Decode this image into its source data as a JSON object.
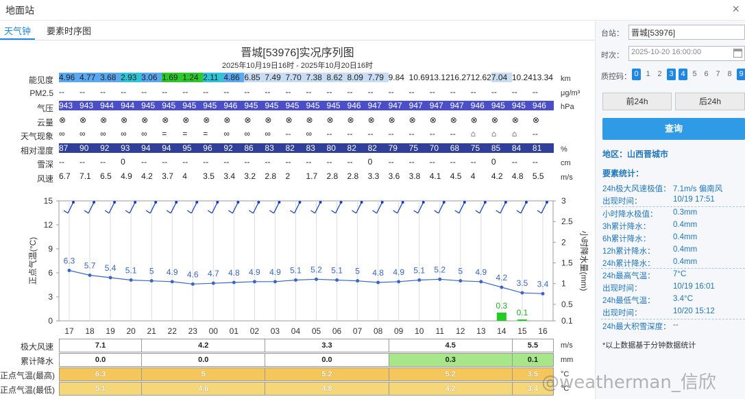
{
  "window": {
    "title": "地面站",
    "close": "×"
  },
  "tabs": [
    {
      "label": "天气钟"
    },
    {
      "label": "要素时序图"
    }
  ],
  "chart_header": {
    "title": "晋城[53976]实况序列图",
    "subtitle": "2025年10月19日16时 - 2025年10月20日16时"
  },
  "table": {
    "hours": [
      "17",
      "18",
      "19",
      "20",
      "21",
      "22",
      "23",
      "00",
      "01",
      "02",
      "03",
      "04",
      "05",
      "06",
      "07",
      "08",
      "09",
      "10",
      "11",
      "12",
      "13",
      "14",
      "15",
      "16"
    ],
    "rows": [
      {
        "label": "能见度",
        "unit": "km",
        "values": [
          "4.96",
          "4.77",
          "3.68",
          "2.93",
          "3.06",
          "1.69",
          "1.24",
          "2.11",
          "4.86",
          "6.85",
          "7.49",
          "7.70",
          "7.38",
          "8.62",
          "8.09",
          "7.79",
          "9.84",
          "10.69",
          "13.12",
          "16.27",
          "12.62",
          "7.04",
          "10.24",
          "13.34"
        ],
        "colors": [
          "#5aa8f0",
          "#5aa8f0",
          "#5aa8f0",
          "#2ec4d4",
          "#5aa8f0",
          "#2cc82c",
          "#2cc82c",
          "#2ec4d4",
          "#5aa8f0",
          "#c8dcf2",
          "#c8dcf2",
          "#c8dcf2",
          "#c8dcf2",
          "#c8dcf2",
          "#c8dcf2",
          "#c8dcf2",
          "#ffffff",
          "#ffffff",
          "#ffffff",
          "#ffffff",
          "#ffffff",
          "#c8dcf2",
          "#ffffff",
          "#ffffff"
        ]
      },
      {
        "label": "PM2.5",
        "unit": "μg/m³",
        "values": [
          "--",
          "--",
          "--",
          "--",
          "--",
          "--",
          "--",
          "--",
          "--",
          "--",
          "--",
          "--",
          "--",
          "--",
          "--",
          "--",
          "--",
          "--",
          "--",
          "--",
          "--",
          "--",
          "--",
          "--"
        ]
      },
      {
        "label": "气压",
        "unit": "hPa",
        "values": [
          "943",
          "943",
          "944",
          "944",
          "945",
          "945",
          "945",
          "945",
          "946",
          "945",
          "945",
          "945",
          "945",
          "945",
          "946",
          "947",
          "947",
          "947",
          "947",
          "947",
          "946",
          "945",
          "945",
          "946"
        ],
        "fill": "#4a4fc8",
        "text_color": "#ffffff"
      },
      {
        "label": "云量",
        "unit": "",
        "values": [
          "⊗",
          "⊗",
          "⊗",
          "⊗",
          "⊗",
          "⊗",
          "⊗",
          "⊗",
          "⊗",
          "⊗",
          "⊗",
          "⊗",
          "⊗",
          "⊗",
          "⊗",
          "⊗",
          "⊗",
          "⊗",
          "⊗",
          "⊗",
          "⊗",
          "⊗",
          "⊗",
          "⊗"
        ]
      },
      {
        "label": "天气现象",
        "unit": "",
        "values": [
          "∞",
          "∞",
          "∞",
          "∞",
          "∞",
          "=",
          "=",
          "=",
          "∞",
          "∞",
          "∞",
          "--",
          "∞",
          "--",
          "--",
          "--",
          "--",
          "--",
          "--",
          "--",
          "⌂",
          "⌂",
          "⌂",
          "--"
        ]
      },
      {
        "label": "相对湿度",
        "unit": "%",
        "values": [
          "87",
          "90",
          "92",
          "93",
          "94",
          "94",
          "95",
          "96",
          "92",
          "86",
          "83",
          "82",
          "83",
          "80",
          "82",
          "82",
          "79",
          "75",
          "70",
          "68",
          "75",
          "85",
          "84",
          "81"
        ],
        "fill": "#2f3f9a",
        "text_color": "#ffffff"
      },
      {
        "label": "雪深",
        "unit": "cm",
        "values": [
          "--",
          "--",
          "--",
          "0",
          "--",
          "--",
          "--",
          "--",
          "--",
          "--",
          "--",
          "--",
          "--",
          "--",
          "--",
          "0",
          "--",
          "--",
          "--",
          "--",
          "--",
          "0",
          "--",
          "--"
        ]
      },
      {
        "label": "风速",
        "unit": "m/s",
        "values": [
          "6.7",
          "7.1",
          "6.5",
          "4.9",
          "4.2",
          "3.7",
          "4",
          "3.5",
          "3.4",
          "3.2",
          "2.8",
          "2",
          "1.7",
          "2.8",
          "2.8",
          "3.3",
          "3.6",
          "3.8",
          "4.1",
          "4.5",
          "4",
          "4.2",
          "4.8",
          "5.5"
        ]
      }
    ]
  },
  "chart_data": {
    "type": "line",
    "x": [
      "17",
      "18",
      "19",
      "20",
      "21",
      "22",
      "23",
      "00",
      "01",
      "02",
      "03",
      "04",
      "05",
      "06",
      "07",
      "08",
      "09",
      "10",
      "11",
      "12",
      "13",
      "14",
      "15",
      "16"
    ],
    "series": [
      {
        "values": [
          6.3,
          5.7,
          5.4,
          5.1,
          5,
          4.9,
          4.6,
          4.7,
          4.8,
          4.9,
          4.9,
          5.1,
          5.2,
          5.1,
          5,
          4.8,
          4.9,
          5.1,
          5.2,
          5,
          4.9,
          4.2,
          3.5,
          3.4
        ]
      }
    ],
    "precip": {
      "values": [
        null,
        null,
        null,
        null,
        null,
        null,
        null,
        null,
        null,
        null,
        null,
        null,
        null,
        null,
        null,
        null,
        null,
        null,
        null,
        null,
        null,
        0.3,
        0.1,
        null
      ]
    },
    "ylabel": "正点气温(°C)",
    "y2label": "小时降水量(mm)",
    "ylim": [
      0,
      15
    ],
    "y2lim": [
      0.1,
      3
    ],
    "yticks": [
      "0",
      "3",
      "6",
      "9",
      "12",
      "15"
    ],
    "y2ticks": [
      "0.1",
      "0.5",
      "1",
      "1.5",
      "2",
      "2.5",
      "3"
    ],
    "line_color": "#3a66c4",
    "bar_color": "#22cc22",
    "grid": true
  },
  "summary_table": {
    "rows": [
      {
        "label": "极大风速",
        "unit": "m/s",
        "values": [
          "7.1",
          "4.2",
          "3.3",
          "4.5",
          "5.5"
        ]
      },
      {
        "label": "累计降水",
        "unit": "mm",
        "values": [
          "0.0",
          "0.0",
          "0.0",
          "0.3",
          "0.1"
        ]
      },
      {
        "label": "正点气温(最高)",
        "unit": "°C",
        "values": [
          "6.3",
          "5",
          "5.2",
          "5.2",
          "3.5"
        ]
      },
      {
        "label": "正点气温(最低)",
        "unit": "°C",
        "values": [
          "5.1",
          "4.6",
          "4.8",
          "4.2",
          "3.4"
        ]
      }
    ]
  },
  "sidebar": {
    "station_label": "台站：",
    "station_value": "晋城[53976]",
    "time_label": "时次：",
    "time_value": "2025-10-20 16:00:00",
    "qc_label": "质控码：",
    "qc_codes": [
      {
        "code": "0",
        "on": true
      },
      {
        "code": "1",
        "on": false
      },
      {
        "code": "2",
        "on": false
      },
      {
        "code": "3",
        "on": true
      },
      {
        "code": "4",
        "on": true
      },
      {
        "code": "5",
        "on": false
      },
      {
        "code": "6",
        "on": false
      },
      {
        "code": "7",
        "on": false
      },
      {
        "code": "8",
        "on": false
      },
      {
        "code": "9",
        "on": true
      }
    ],
    "prev_button": "前24h",
    "next_button": "后24h",
    "query_button": "查询",
    "region": "地区：山西晋城市",
    "stats_title": "要素统计：",
    "stats": [
      {
        "label": "24h极大风速极值：",
        "value": "7.1m/s 偏南风"
      },
      {
        "label": "出现时间：",
        "value": "10/19 17:51"
      },
      {
        "label": "小时降水极值：",
        "value": "0.3mm"
      },
      {
        "label": "3h累计降水：",
        "value": "0.4mm"
      },
      {
        "label": "6h累计降水：",
        "value": "0.4mm"
      },
      {
        "label": "12h累计降水：",
        "value": "0.4mm"
      },
      {
        "label": "24h累计降水：",
        "value": "0.4mm"
      },
      {
        "label": "24h最高气温：",
        "value": "7°C"
      },
      {
        "label": "出现时间：",
        "value": "10/19 16:01"
      },
      {
        "label": "24h最低气温：",
        "value": "3.4°C"
      },
      {
        "label": "出现时间：",
        "value": "10/20 15:12"
      },
      {
        "label": "24h最大积雪深度：",
        "value": "--"
      }
    ],
    "note": "*以上数据基于分钟数据统计"
  },
  "watermark": "@weatherman_信欣"
}
